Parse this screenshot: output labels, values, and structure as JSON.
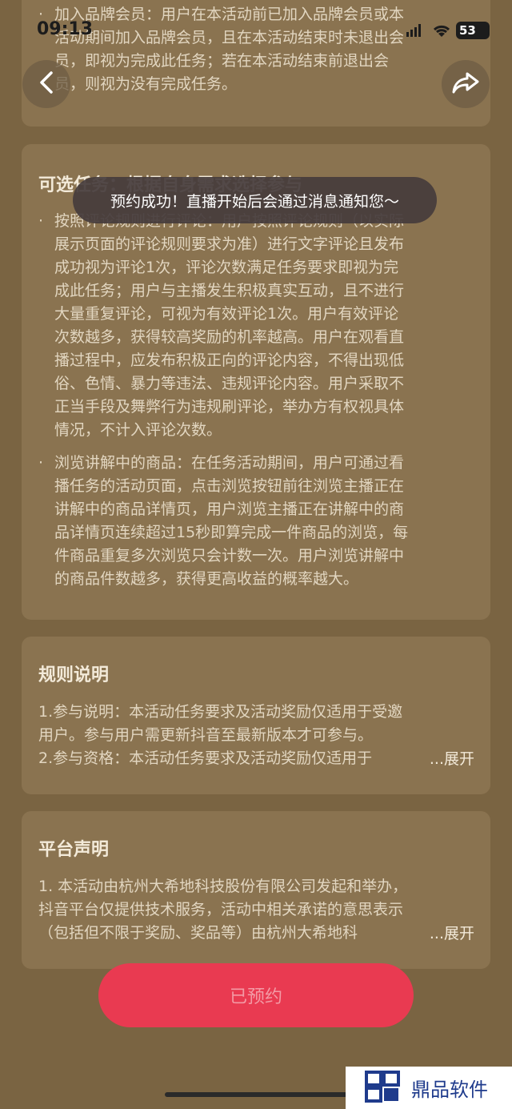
{
  "status_bar": {
    "time": "09:13",
    "battery": "53"
  },
  "nav": {
    "back_icon": "chevron-left-icon",
    "share_icon": "share-icon"
  },
  "card1": {
    "lines": [
      "加入品牌会员：用户在本活动前已加入品牌会员或本",
      "活动期间加入品牌会员，且在本活动结束时未退出会",
      "员，即视为完成此任务；若在本活动结束前退出会",
      "员，则视为没有完成任务。"
    ]
  },
  "card2": {
    "title": "可选任务：根据自身需求选择参与",
    "bullet1_lines": [
      "按照评论规则进行评论：用户按照评论规则（以实际",
      "展示页面的评论规则要求为准）进行文字评论且发布",
      "成功视为评论1次，评论次数满足任务要求即视为完",
      "成此任务；用户与主播发生积极真实互动，且不进行",
      "大量重复评论，可视为有效评论1次。用户有效评论",
      "次数越多，获得较高奖励的机率越高。用户在观看直",
      "播过程中，应发布积极正向的评论内容，不得出现低",
      "俗、色情、暴力等违法、违规评论内容。用户采取不",
      "正当手段及舞弊行为违规刷评论，举办方有权视具体",
      "情况，不计入评论次数。"
    ],
    "bullet2_lines": [
      "浏览讲解中的商品：在任务活动期间，用户可通过看",
      "播任务的活动页面，点击浏览按钮前往浏览主播正在",
      "讲解中的商品详情页，用户浏览主播正在讲解中的商",
      "品详情页连续超过15秒即算完成一件商品的浏览，每",
      "件商品重复多次浏览只会计数一次。用户浏览讲解中",
      "的商品件数越多，获得更高收益的概率越大。"
    ]
  },
  "card3": {
    "title": "规则说明",
    "lines": [
      "1.参与说明：本活动任务要求及活动奖励仅适用于受邀",
      "用户。参与用户需更新抖音至最新版本才可参与。",
      "2.参与资格：本活动任务要求及活动奖励仅适用于"
    ],
    "expand": "...展开"
  },
  "card4": {
    "title": "平台声明",
    "lines": [
      "1. 本活动由杭州大希地科技股份有限公司发起和举办，",
      "抖音平台仅提供技术服务，活动中相关承诺的意思表示",
      "（包括但不限于奖励、奖品等）由杭州大希地科"
    ],
    "expand": "...展开"
  },
  "toast": "预约成功！直播开始后会通过消息通知您～",
  "reserve_button": "已预约",
  "watermark": "鼎品软件",
  "colors": {
    "background": "#7a6442",
    "card": "#8a7350",
    "button": "#e93a51",
    "toast": "#463c3c"
  }
}
